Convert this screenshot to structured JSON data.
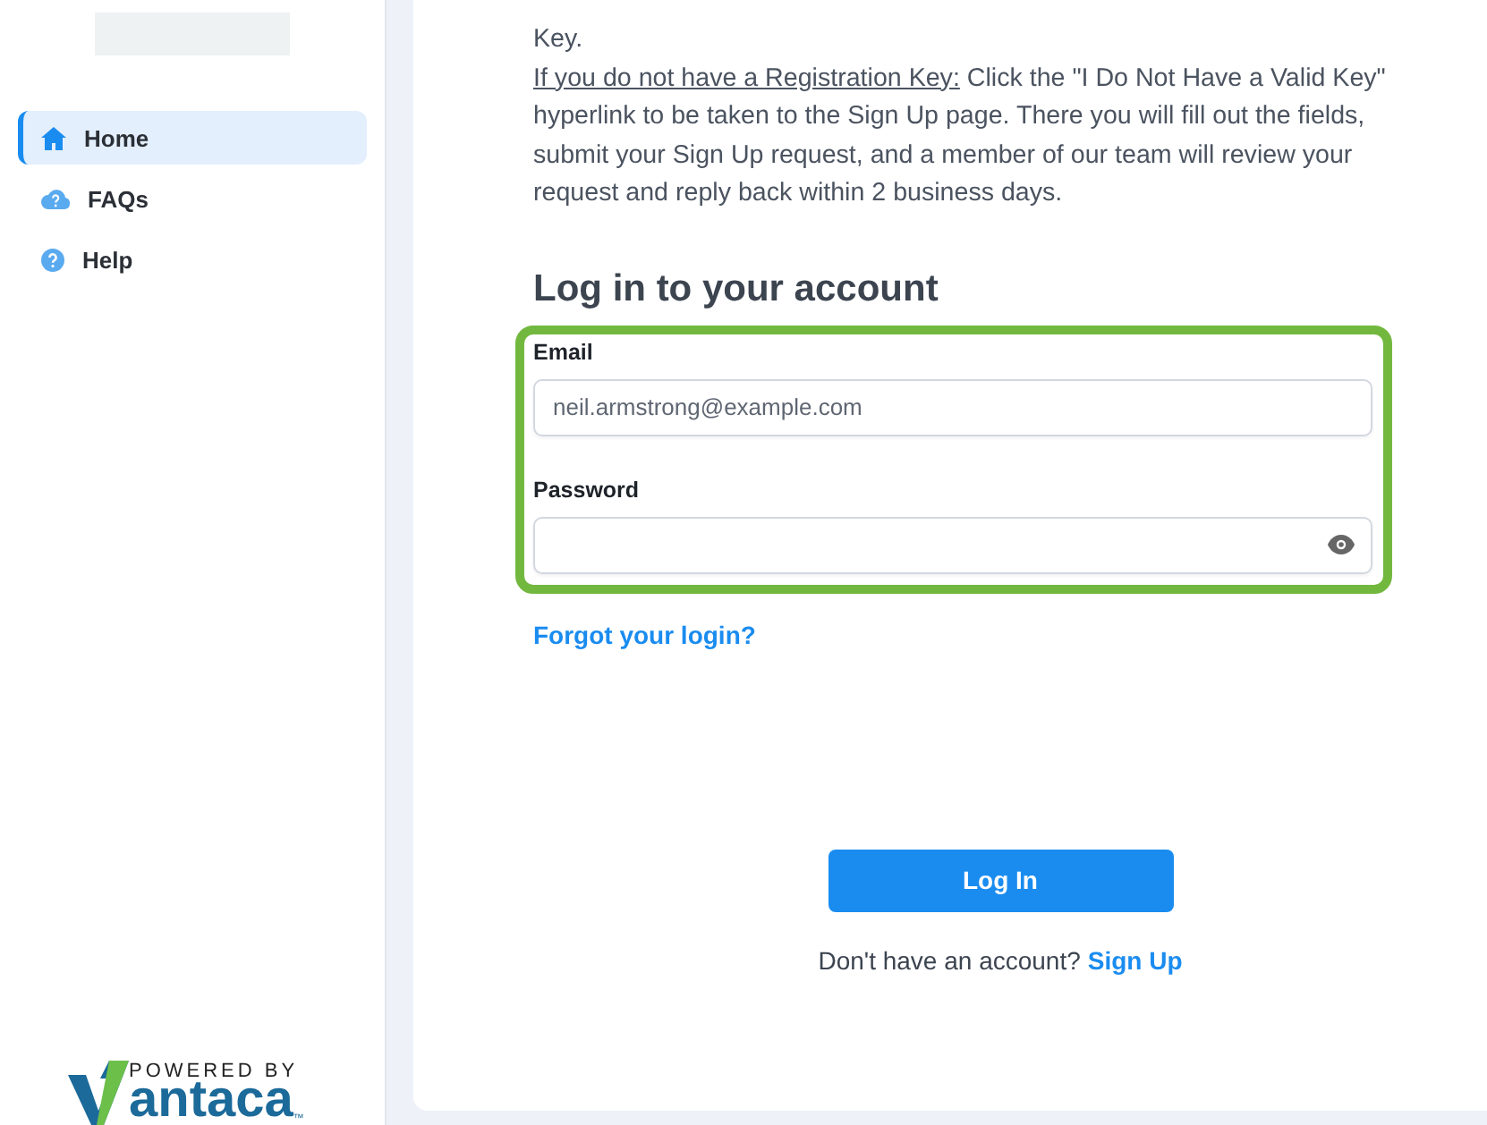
{
  "sidebar": {
    "items": [
      {
        "label": "Home",
        "kind": "home",
        "selected": true
      },
      {
        "label": "FAQs",
        "kind": "faq",
        "selected": false
      },
      {
        "label": "Help",
        "kind": "help",
        "selected": false
      }
    ],
    "footer": {
      "tagline": "POWERED BY",
      "wordmark": "antaca",
      "trademark": "™"
    }
  },
  "intro": {
    "first_line": "Key.",
    "lead": "If you do not have a Registration Key:",
    "body": " Click the \"I Do Not Have a Valid Key\" hyperlink to be taken to the Sign Up page. There you will fill out the fields, submit your Sign Up request, and a member of our team will review your request and reply back within 2 business days."
  },
  "login": {
    "title": "Log in to your account",
    "fields": [
      {
        "label": "Email",
        "placeholder": "neil.armstrong@example.com",
        "kind": "text"
      },
      {
        "label": "Password",
        "kind": "password"
      }
    ],
    "forgot": "Forgot your login?",
    "submit": "Log In",
    "signup_prompt": "Don't have an account?",
    "signup_link": "Sign Up"
  }
}
